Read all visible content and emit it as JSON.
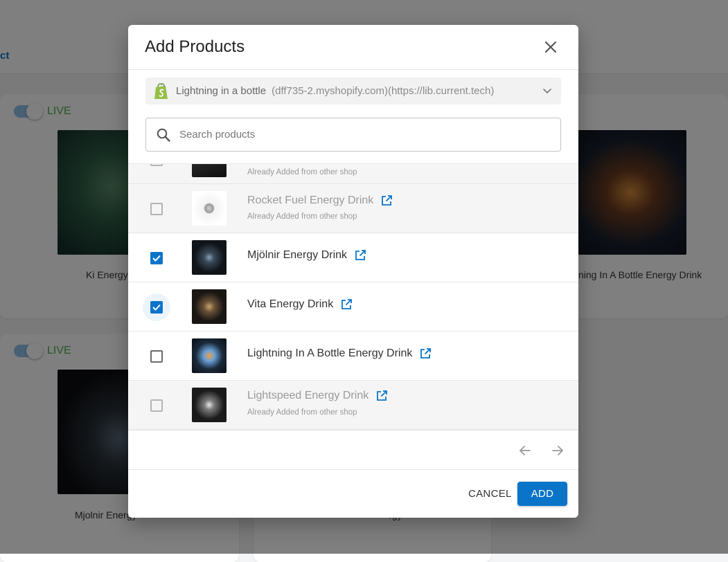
{
  "background": {
    "tab_label": "ct",
    "live_label": "LIVE",
    "captions": [
      "Ki Energy",
      "ning In A Bottle Energy Drink",
      "Mjolnir Energy",
      "rgy"
    ]
  },
  "modal": {
    "title": "Add Products",
    "shop": {
      "name": "Lightning in a bottle",
      "url": "(dff735-2.myshopify.com)(https://lib.current.tech)"
    },
    "search": {
      "placeholder": "Search products",
      "value": ""
    },
    "products": [
      {
        "name": "",
        "note": "Already Added from other shop",
        "state": "disabled"
      },
      {
        "name": "Rocket Fuel Energy Drink",
        "note": "Already Added from other shop",
        "state": "disabled"
      },
      {
        "name": "Mjölnir Energy Drink",
        "note": "",
        "state": "checked"
      },
      {
        "name": "Vita Energy Drink",
        "note": "",
        "state": "checked"
      },
      {
        "name": "Lightning In A Bottle Energy Drink",
        "note": "",
        "state": "unchecked"
      },
      {
        "name": "Lightspeed Energy Drink",
        "note": "Already Added from other shop",
        "state": "disabled"
      }
    ],
    "cancel_label": "CANCEL",
    "add_label": "ADD"
  },
  "colors": {
    "accent": "#0a74c9",
    "live_green": "#4caf50",
    "shopify_green": "#95bf47"
  },
  "icons": [
    "close-icon",
    "shopify-icon",
    "chevron-down-icon",
    "search-icon",
    "external-link-icon",
    "arrow-left-icon",
    "arrow-right-icon"
  ]
}
